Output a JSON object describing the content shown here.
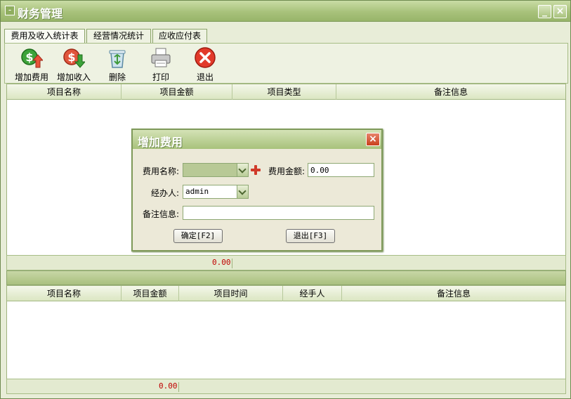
{
  "window": {
    "title": "财务管理",
    "icon": "window-menu-icon",
    "min_label": "_",
    "close_label": "×"
  },
  "tabs": [
    {
      "label": "费用及收入统计表",
      "active": true
    },
    {
      "label": "经营情况统计"
    },
    {
      "label": "应收应付表"
    }
  ],
  "toolbar": {
    "add_expense": "增加费用",
    "add_income": "增加收入",
    "delete": "删除",
    "print": "打印",
    "exit": "退出"
  },
  "grid1": {
    "columns": [
      "项目名称",
      "项目金额",
      "项目类型",
      "备注信息"
    ],
    "rows": [],
    "total": "0.00"
  },
  "grid2": {
    "columns": [
      "项目名称",
      "项目金额",
      "项目时间",
      "经手人",
      "备注信息"
    ],
    "rows": [],
    "total": "0.00"
  },
  "dialog": {
    "title": "增加费用",
    "close_label": "×",
    "expense_name_label": "费用名称:",
    "expense_name_value": "",
    "amount_label": "费用金额:",
    "amount_value": "0.00",
    "handler_label": "经办人:",
    "handler_value": "admin",
    "remark_label": "备注信息:",
    "remark_value": "",
    "confirm_label": "确定[F2]",
    "exit_label": "退出[F3]"
  },
  "colors": {
    "accent": "#a8c27b",
    "total_text": "#c00000",
    "close_red": "#c9401c"
  }
}
